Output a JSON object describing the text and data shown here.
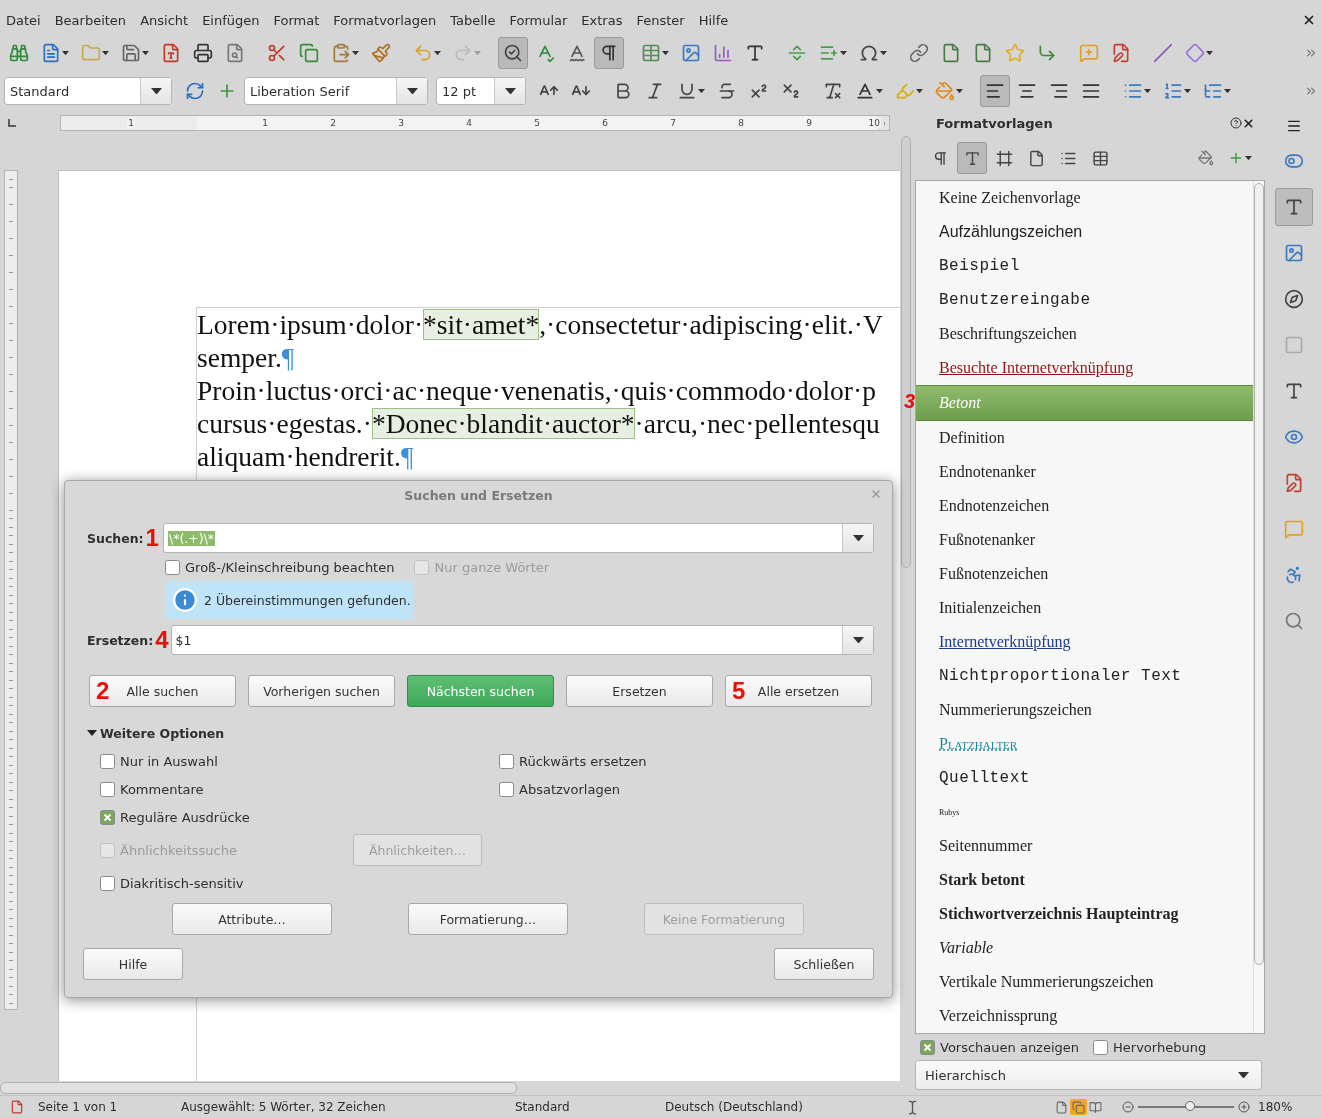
{
  "menu": [
    "Datei",
    "Bearbeiten",
    "Ansicht",
    "Einfügen",
    "Format",
    "Formatvorlagen",
    "Tabelle",
    "Formular",
    "Extras",
    "Fenster",
    "Hilfe"
  ],
  "standard_toolbar": {
    "auto_spellcheck_on": true,
    "formatting_marks_on": true,
    "redo_disabled": true
  },
  "formatting_toolbar": {
    "paragraph_style": "Standard",
    "font_name": "Liberation Serif",
    "font_size": "12 pt",
    "alignments": [
      {
        "selected": true
      },
      {
        "selected": false
      },
      {
        "selected": false
      },
      {
        "selected": false
      }
    ]
  },
  "ruler": {
    "labels": [
      "1",
      "1",
      "2",
      "3",
      "4",
      "5",
      "6",
      "7",
      "8",
      "9",
      "10"
    ]
  },
  "document": {
    "lines": [
      [
        {
          "kind": "text",
          "text": "Lorem·ipsum·dolor·"
        },
        {
          "kind": "match",
          "text": "*sit·amet*"
        },
        {
          "kind": "text",
          "text": ",·consectetur·adipiscing·elit.·V"
        }
      ],
      [
        {
          "kind": "text",
          "text": "semper."
        },
        {
          "kind": "mark",
          "text": "¶"
        }
      ],
      [
        {
          "kind": "text",
          "text": "Proin·luctus·orci·ac·neque·venenatis,·quis·commodo·dolor·p"
        }
      ],
      [
        {
          "kind": "text",
          "text": "cursus·egestas.·"
        },
        {
          "kind": "match",
          "text": "*Donec·blandit·auctor*"
        },
        {
          "kind": "text",
          "text": "·arcu,·nec·pellentesqu"
        }
      ],
      [
        {
          "kind": "text",
          "text": "aliquam·hendrerit."
        },
        {
          "kind": "mark",
          "text": "¶"
        }
      ]
    ]
  },
  "dialog": {
    "title": "Suchen und Ersetzen",
    "search": {
      "label": "Suchen:",
      "marker": "1",
      "value": "\\*(.+)\\*",
      "value_selected": true
    },
    "match_case": {
      "label": "Groß-/Kleinschreibung beachten",
      "checked": false,
      "disabled": false
    },
    "whole_words": {
      "label": "Nur ganze Wörter",
      "checked": false,
      "disabled": true
    },
    "info": "2 Übereinstimmungen gefunden.",
    "replace": {
      "label": "Ersetzen:",
      "marker": "4",
      "value": "$1"
    },
    "actions": [
      {
        "label": "Alle suchen",
        "marker": "2",
        "default": false
      },
      {
        "label": "Vorherigen suchen",
        "default": false
      },
      {
        "label": "Nächsten suchen",
        "default": true
      },
      {
        "label": "Ersetzen",
        "default": false
      },
      {
        "label": "Alle ersetzen",
        "marker": "5",
        "default": false
      }
    ],
    "more_options": {
      "label": "Weitere Optionen",
      "expanded": true
    },
    "options": [
      {
        "label": "Nur in Auswahl",
        "checked": false,
        "disabled": false
      },
      {
        "label": "Rückwärts ersetzen",
        "checked": false,
        "disabled": false
      },
      {
        "label": "Kommentare",
        "checked": false,
        "disabled": false
      },
      {
        "label": "Absatzvorlagen",
        "checked": false,
        "disabled": false
      },
      {
        "label": "Reguläre Ausdrücke",
        "checked": true,
        "disabled": false
      }
    ],
    "similarity": {
      "label": "Ähnlichkeitssuche",
      "checked": false,
      "disabled": true,
      "button": "Ähnlichkeiten…",
      "button_disabled": true
    },
    "diacritics": {
      "label": "Diakritisch-sensitiv",
      "checked": false,
      "disabled": false
    },
    "format_buttons": [
      {
        "label": "Attribute…",
        "disabled": false
      },
      {
        "label": "Formatierung…",
        "disabled": false
      },
      {
        "label": "Keine Formatierung",
        "disabled": true
      }
    ],
    "help": "Hilfe",
    "close": "Schließen"
  },
  "sidebar": {
    "title": "Formatvorlagen",
    "families": [
      {
        "selected": false
      },
      {
        "selected": true
      },
      {
        "selected": false
      },
      {
        "selected": false
      },
      {
        "selected": false
      },
      {
        "selected": false
      }
    ],
    "styles": [
      {
        "name": "Keine Zeichenvorlage",
        "kind": "serif",
        "selected": false
      },
      {
        "name": "Aufzählungszeichen",
        "kind": "sans",
        "selected": false
      },
      {
        "name": "Beispiel",
        "kind": "mono",
        "selected": false
      },
      {
        "name": "Benutzereingabe",
        "kind": "mono",
        "selected": false
      },
      {
        "name": "Beschriftungszeichen",
        "kind": "serif",
        "selected": false
      },
      {
        "name": "Besuchte Internetverknüpfung",
        "kind": "visited",
        "selected": false
      },
      {
        "name": "Betont",
        "kind": "italic",
        "selected": true,
        "marker": "3"
      },
      {
        "name": "Definition",
        "kind": "serif",
        "selected": false
      },
      {
        "name": "Endnotenanker",
        "kind": "serif",
        "selected": false
      },
      {
        "name": "Endnotenzeichen",
        "kind": "serif",
        "selected": false
      },
      {
        "name": "Fußnotenanker",
        "kind": "serif",
        "selected": false
      },
      {
        "name": "Fußnotenzeichen",
        "kind": "serif",
        "selected": false
      },
      {
        "name": "Initialenzeichen",
        "kind": "serif",
        "selected": false
      },
      {
        "name": "Internetverknüpfung",
        "kind": "link",
        "selected": false
      },
      {
        "name": "Nichtproportionaler Text",
        "kind": "mono",
        "selected": false
      },
      {
        "name": "Nummerierungszeichen",
        "kind": "serif",
        "selected": false
      },
      {
        "name": "Platzhalter",
        "kind": "smallcaps",
        "selected": false
      },
      {
        "name": "Quelltext",
        "kind": "mono",
        "selected": false
      },
      {
        "name": "Rubys",
        "kind": "tiny",
        "selected": false
      },
      {
        "name": "Seitennummer",
        "kind": "serif",
        "selected": false
      },
      {
        "name": "Stark betont",
        "kind": "bold",
        "selected": false
      },
      {
        "name": "Stichwortverzeichnis Haupteintrag",
        "kind": "bold",
        "selected": false
      },
      {
        "name": "Variable",
        "kind": "italic",
        "selected": false
      },
      {
        "name": "Vertikale Nummerierungszeichen",
        "kind": "serif",
        "selected": false
      },
      {
        "name": "Verzeichnissprung",
        "kind": "serif",
        "selected": false
      }
    ],
    "show_previews": {
      "label": "Vorschauen anzeigen",
      "checked": true
    },
    "highlighting": {
      "label": "Hervorhebung",
      "checked": false
    },
    "filter": "Hierarchisch"
  },
  "deck_tabs": [
    {
      "selected": false
    },
    {
      "selected": true
    },
    {
      "selected": false
    },
    {
      "selected": false
    },
    {
      "selected": false
    },
    {
      "selected": false
    },
    {
      "selected": false
    },
    {
      "selected": false
    },
    {
      "selected": false
    },
    {
      "selected": false
    },
    {
      "selected": false
    }
  ],
  "status_bar": {
    "page": "Seite 1 von 1",
    "selection": "Ausgewählt: 5 Wörter, 32 Zeichen",
    "page_style": "Standard",
    "language": "Deutsch (Deutschland)",
    "views": [
      {
        "selected": false
      },
      {
        "selected": true
      },
      {
        "selected": false
      }
    ],
    "zoom": {
      "level": 0.55,
      "reading": "180%"
    }
  }
}
